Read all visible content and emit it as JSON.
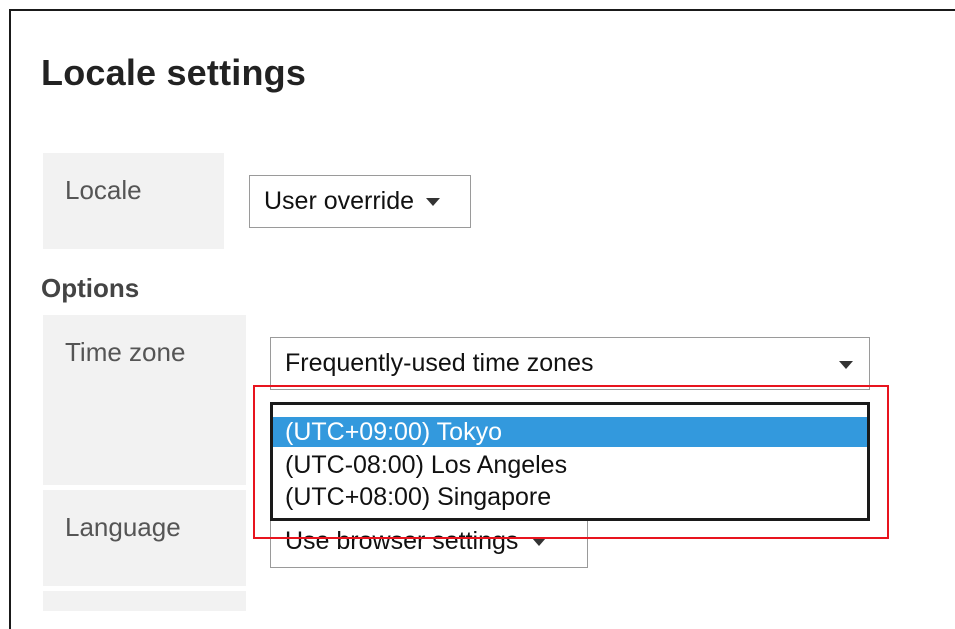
{
  "page": {
    "title": "Locale settings"
  },
  "locale": {
    "label": "Locale",
    "select_value": "User override"
  },
  "options": {
    "heading": "Options",
    "time_zone": {
      "label": "Time zone",
      "select_value": "Frequently-used time zones",
      "options": [
        {
          "text": "(UTC+09:00) Tokyo",
          "selected": true
        },
        {
          "text": "(UTC-08:00) Los Angeles",
          "selected": false
        },
        {
          "text": "(UTC+08:00) Singapore",
          "selected": false
        }
      ]
    },
    "language": {
      "label": "Language",
      "select_value": "Use browser settings"
    }
  },
  "colors": {
    "highlight": "#e8141e",
    "selected_option": "#3399dd"
  }
}
